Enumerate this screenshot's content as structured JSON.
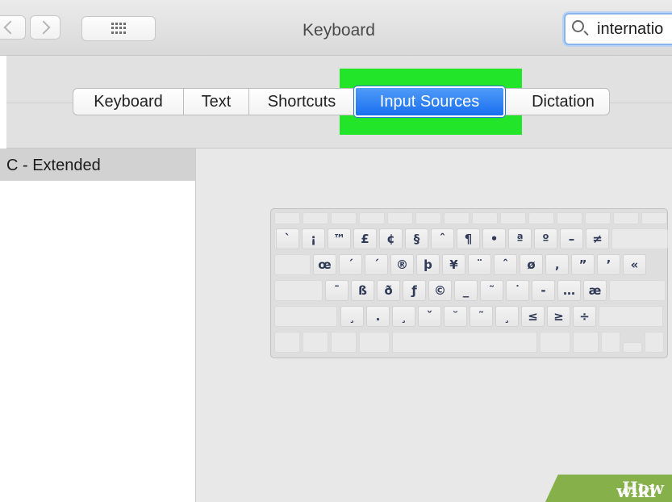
{
  "window": {
    "title": "Keyboard"
  },
  "search": {
    "value": "internatio"
  },
  "tabs": [
    {
      "label": "Keyboard"
    },
    {
      "label": "Text"
    },
    {
      "label": "Shortcuts"
    },
    {
      "label": "Input Sources",
      "selected": true
    },
    {
      "label": "Dictation"
    }
  ],
  "sidebar": {
    "selected_item": "C - Extended"
  },
  "keyboard": {
    "row1": [
      "`",
      "¡",
      "™",
      "£",
      "¢",
      "§",
      "ˆ",
      "¶",
      "•",
      "ª",
      "º",
      "–",
      "≠"
    ],
    "row2": [
      "œ",
      "´",
      "´",
      "®",
      "þ",
      "¥",
      "¨",
      "ˆ",
      "ø",
      "‚",
      "”",
      "’",
      "«"
    ],
    "row3": [
      "¯",
      "ß",
      "ð",
      "ƒ",
      "©",
      "_",
      "˜",
      "˙",
      "-",
      "…",
      "æ"
    ],
    "row4": [
      "¸",
      ".",
      "¸",
      "ˇ",
      "˘",
      "˜",
      "¸",
      "≤",
      "≥",
      "÷"
    ]
  },
  "watermark": {
    "wiki": "wiki",
    "how": "How"
  },
  "colors": {
    "highlight": "#22e52a",
    "active_tab": "#1a6ff0",
    "brand_green": "#86b04a"
  }
}
